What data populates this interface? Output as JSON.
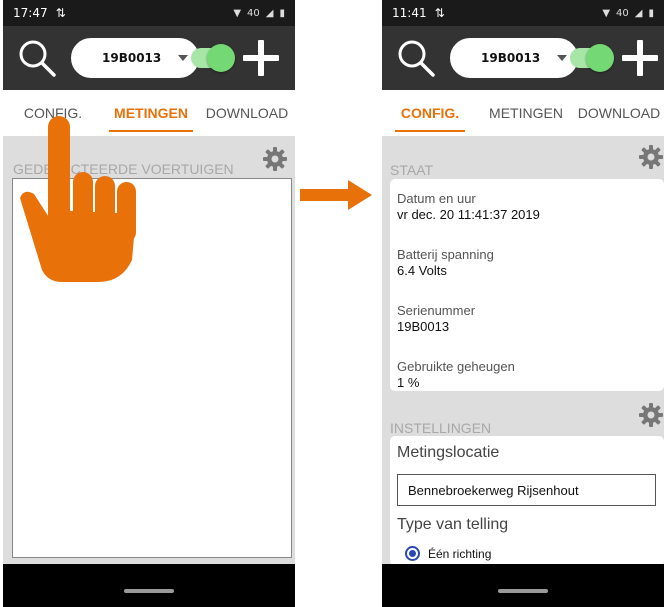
{
  "left_screen": {
    "status": {
      "time": "17:47",
      "sync_icon": "sync-icon",
      "signal_text": "40"
    },
    "toolbar": {
      "device": "19B0013",
      "toggle_on": true
    },
    "tabs": [
      {
        "label": "CONFIG."
      },
      {
        "label": "METINGEN"
      },
      {
        "label": "DOWNLOAD"
      }
    ],
    "active_tab": "METINGEN",
    "section_title": "GEDETECTEERDE VOERTUIGEN"
  },
  "right_screen": {
    "status": {
      "time": "11:41",
      "sync_icon": "sync-icon",
      "signal_text": "40"
    },
    "toolbar": {
      "device": "19B0013",
      "toggle_on": true
    },
    "tabs": [
      {
        "label": "CONFIG."
      },
      {
        "label": "METINGEN"
      },
      {
        "label": "DOWNLOAD"
      }
    ],
    "active_tab": "CONFIG.",
    "staat": {
      "title": "STAAT",
      "fields": [
        {
          "label": "Datum en uur",
          "value": "vr dec. 20 11:41:37 2019"
        },
        {
          "label": "Batterij spanning",
          "value": "6.4 Volts"
        },
        {
          "label": "Serienummer",
          "value": "19B0013"
        },
        {
          "label": "Gebruikte geheugen",
          "value": "1 %"
        }
      ]
    },
    "instellingen": {
      "title": "INSTELLINGEN",
      "location_label": "Metingslocatie",
      "location_value": "Bennebroekerweg Rijsenhout",
      "count_type_label": "Type van telling",
      "count_option": "Één richting"
    }
  },
  "colors": {
    "accent": "#e8710a",
    "toolbar": "#333333",
    "statusbar": "#1a1a1a",
    "content_bg": "#dddddd",
    "toggle": "#74d874",
    "radio": "#2b4ab0"
  }
}
